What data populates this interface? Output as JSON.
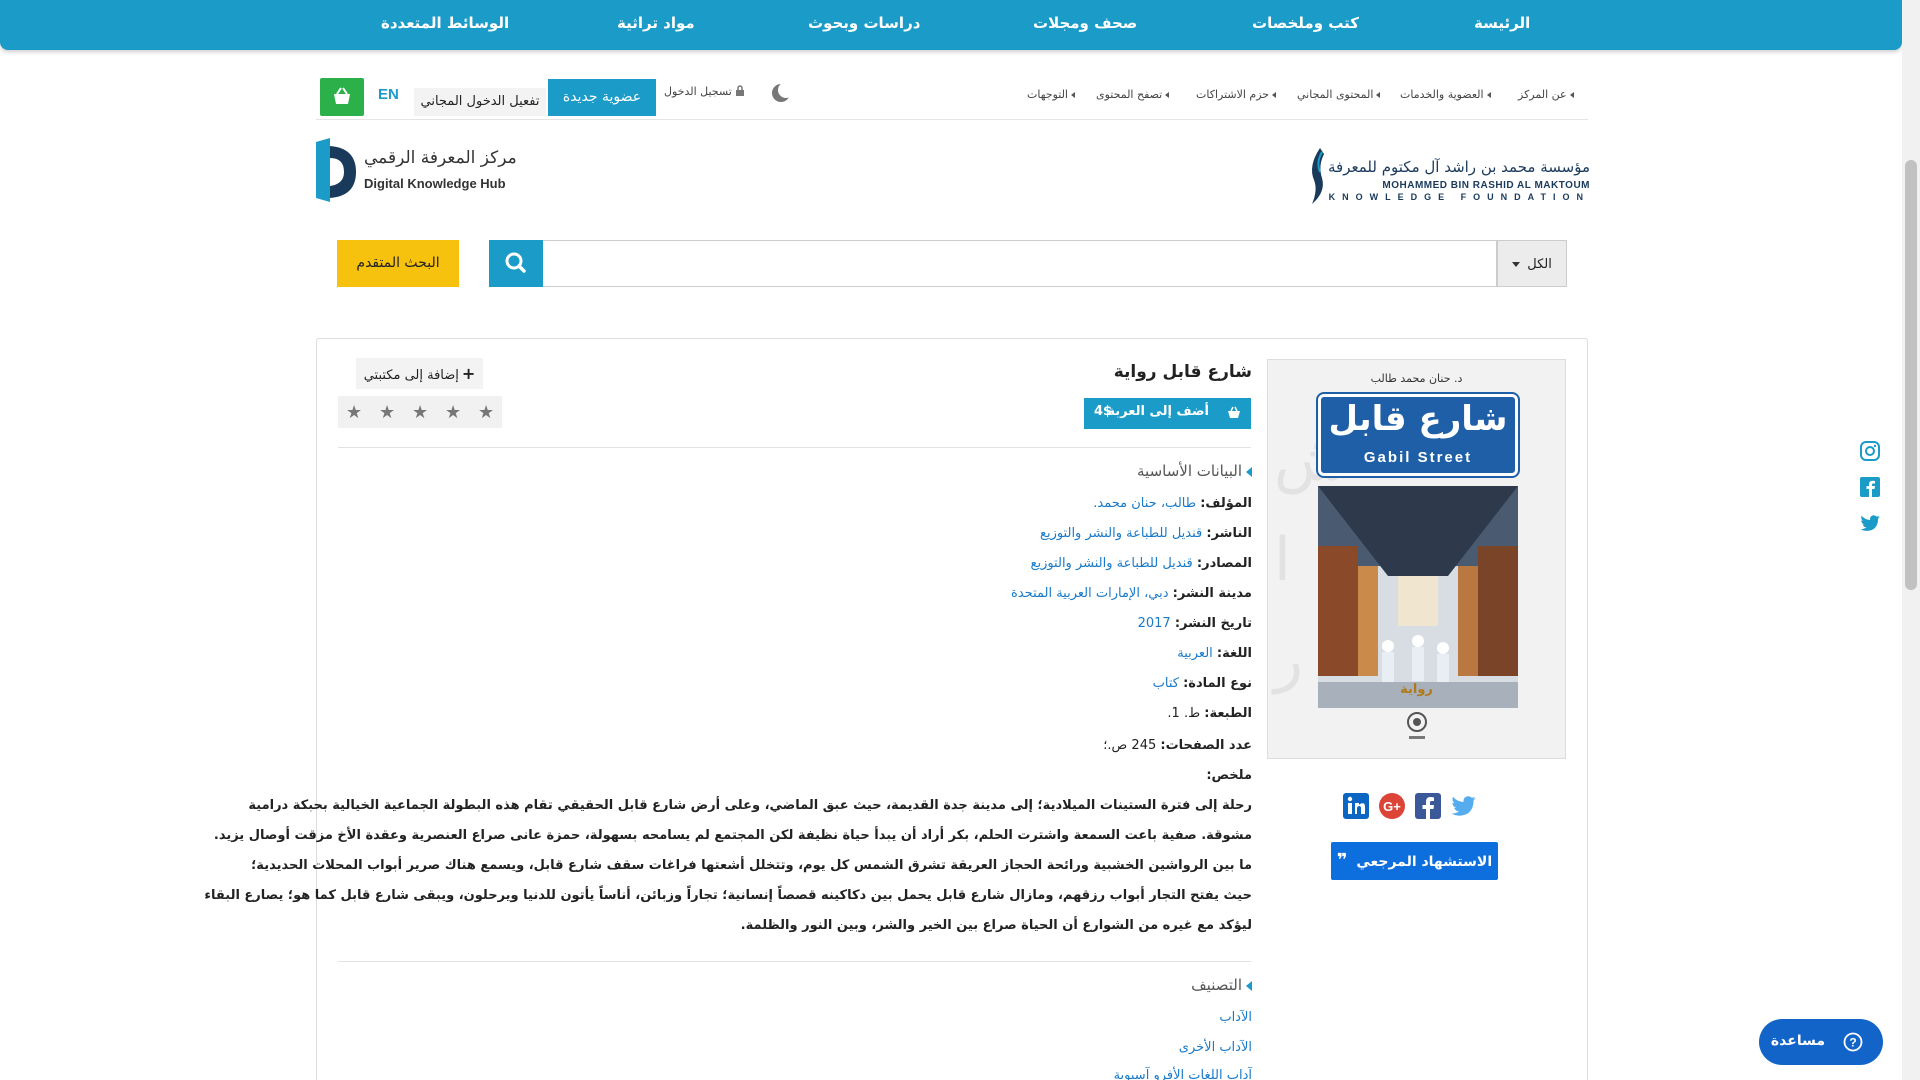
{
  "nav": {
    "items": [
      "الرئيسة",
      "كتب وملخصات",
      "صحف ومجلات",
      "دراسات وبحوث",
      "مواد تراثية",
      "الوسائط المتعددة"
    ]
  },
  "utility": {
    "breadcrumbs": [
      "عن المركز",
      "العضوية والخدمات",
      "المحتوى المجاني",
      "حزم الاشتراكات",
      "تصفح المحتوى",
      "التوجهات"
    ],
    "login": "تسجيل الدخول",
    "new_member": "عضوية جديدة",
    "free_access": "تفعيل الدخول المجاني",
    "lang": "EN",
    "cart_icon": "basket-icon",
    "theme_icon": "moon-icon"
  },
  "logos": {
    "dkh_ar": "مركز المعرفة الرقمي",
    "dkh_en": "Digital Knowledge Hub",
    "mbr_ar": "مؤسسة محمد بن راشد آل مكتوم للمعرفة",
    "mbr_en1": "MOHAMMED BIN RASHID AL MAKTOUM",
    "mbr_en2": "KNOWLEDGE FOUNDATION"
  },
  "search": {
    "scope": "الكل",
    "placeholder": "",
    "advanced": "البحث المتقدم"
  },
  "book": {
    "title": "شارع قابل رواية",
    "add_to_cart": "أضف إلى العربة",
    "price": "4$",
    "add_to_library": "إضافة إلى مكتبتي",
    "rating_stars": 5,
    "rating_value": 0,
    "cite": "الاستشهاد المرجعي",
    "cover": {
      "author": "د. حنان محمد طالب",
      "title_ar": "شارع قابل",
      "title_en": "Gabil Street",
      "genre": "رواية"
    }
  },
  "basic": {
    "heading": "البيانات الأساسية",
    "fields": [
      {
        "k": "المؤلف:",
        "v": "طالب، حنان محمد.",
        "link": true
      },
      {
        "k": "الناشر:",
        "v": "قنديل للطباعة والنشر والتوزيع",
        "link": true
      },
      {
        "k": "المصادر:",
        "v": "قنديل للطباعة والنشر والتوزيع",
        "link": true
      },
      {
        "k": "مدينة النشر:",
        "v": "دبي، الإمارات العربية المتحدة",
        "link": true
      },
      {
        "k": "تاريخ النشر:",
        "v": "2017",
        "link": true
      },
      {
        "k": "اللغة:",
        "v": "العربية",
        "link": true
      },
      {
        "k": "نوع المادة:",
        "v": "كتاب",
        "link": true
      },
      {
        "k": "الطبعة:",
        "v": "ط. 1.",
        "link": false
      },
      {
        "k": "عدد الصفحات:",
        "v": "245 ص.؛",
        "link": false
      }
    ],
    "summary_label": "ملخص:",
    "summary_lines": [
      "رحلة إلى فترة الستينات الميلادية؛ إلى مدينة جدة القديمة، حيث عبق الماضي، وعلى أرض شارع قابل الحقيقي تقام هذه البطولة الجماعية الخيالية بحبكة درامية",
      "مشوقة. صفية باعت السمعة واشترت الحلم، بكر أراد أن يبدأ حياة نظيفة لكن المجتمع لم يسامحه بسهولة، حمزة عانى صراع العنصرية وعقدة الأخ مزقت أوصال يزيد.",
      "ما بين الرواشين الخشبية ورائحة الحجاز العريقة تشرق الشمس كل يوم، وتتخلل أشعتها فراغات سقف شارع قابل، ويسمع هناك صرير أبواب المحلات الحديدية؛",
      "حيث يفتح التجار أبواب رزقهم، ومازال شارع قابل يحمل بين دكاكينه قصصاً إنسانية؛ تجاراً وزبائن، أناساً يأتون للدنيا ويرحلون، ويبقى شارع قابل كما هو؛ يصارع البقاء",
      "ليؤكد مع غيره من الشوارع أن الحياة صراع بين الخير والشر، وبين النور والظلمة."
    ]
  },
  "classification": {
    "heading": "التصنيف",
    "items": [
      "الآداب",
      "الآداب الأخرى",
      "آداب اللغات الأفرو آسيوية"
    ]
  },
  "share": [
    "linkedin-icon",
    "google-plus-icon",
    "facebook-icon",
    "twitter-icon"
  ],
  "side_social": [
    "instagram-icon",
    "facebook-icon",
    "twitter-icon"
  ],
  "help": {
    "label": "مساعدة"
  },
  "colors": {
    "brand": "#1a9bc8",
    "green": "#2bb04a",
    "yellow": "#f7c20e",
    "cite": "#0d6ede",
    "help": "#1364c8"
  }
}
